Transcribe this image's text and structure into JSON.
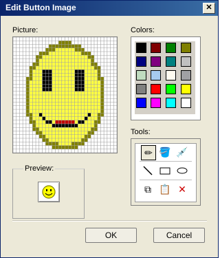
{
  "window": {
    "title": "Edit Button Image",
    "close_glyph": "✕"
  },
  "labels": {
    "picture": "Picture:",
    "colors": "Colors:",
    "tools": "Tools:",
    "preview": "Preview:"
  },
  "buttons": {
    "ok": "OK",
    "cancel": "Cancel"
  },
  "colors": [
    [
      "#000000",
      "#800000",
      "#008000",
      "#808000"
    ],
    [
      "#000080",
      "#800080",
      "#008080",
      "#c0c0c0"
    ],
    [
      "#c0dcc0",
      "#a6caf0",
      "#fffbf0",
      "#a0a0a4"
    ],
    [
      "#808080",
      "#ff0000",
      "#00ff00",
      "#ffff00"
    ],
    [
      "#0000ff",
      "#ff00ff",
      "#00ffff",
      "#ffffff"
    ]
  ],
  "tools": {
    "row1": [
      "pencil-icon",
      "fill-bucket-icon",
      "eyedropper-icon"
    ],
    "row2": [
      "line-icon",
      "rectangle-icon",
      "ellipse-icon"
    ],
    "row3": [
      "copy-icon",
      "paste-icon",
      "clear-icon"
    ]
  }
}
